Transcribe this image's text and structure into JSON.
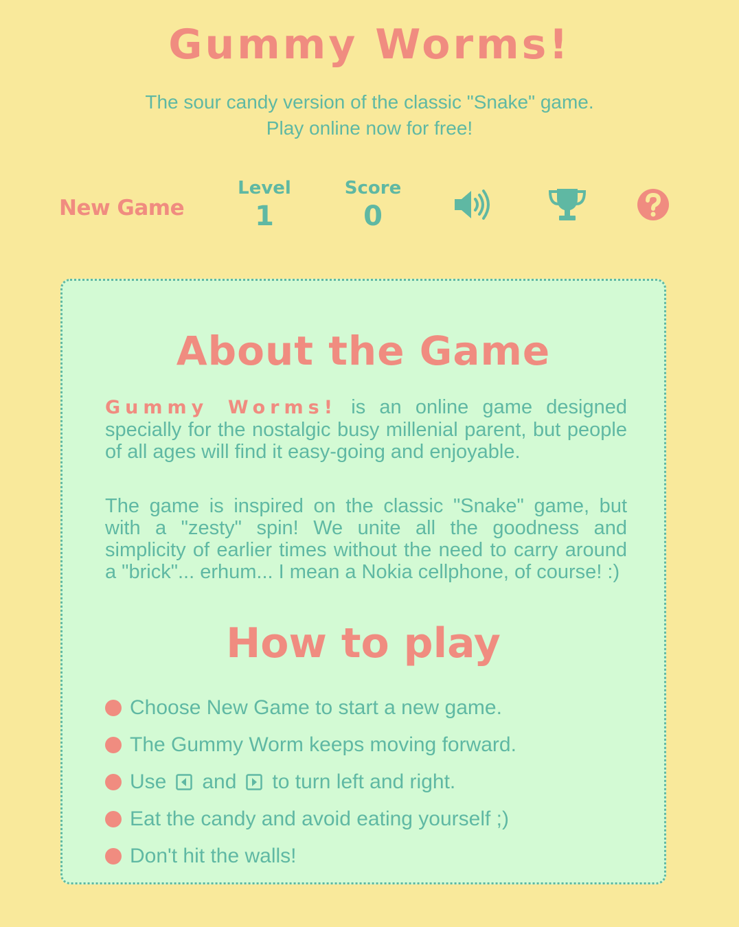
{
  "header": {
    "title": "Gummy Worms!",
    "subtitle_line1": "The sour candy version of the classic \"Snake\" game.",
    "subtitle_line2": "Play online now for free!"
  },
  "toolbar": {
    "new_game_label": "New Game",
    "level_label": "Level",
    "level_value": "1",
    "score_label": "Score",
    "score_value": "0",
    "icons": [
      "speaker-icon",
      "trophy-icon",
      "help-icon"
    ]
  },
  "about": {
    "heading": "About the Game",
    "brand": "Gummy Worms!",
    "para1_rest": " is an online game designed specially for the nostalgic busy millenial parent, but people of all ages will find it easy-going and enjoyable.",
    "para2": "The game is inspired on the classic \"Snake\" game, but with a \"zesty\" spin! We unite all the goodness and simplicity of earlier times without the need to carry around a \"brick\"... erhum... I mean a Nokia cellphone, of course! :)"
  },
  "howto": {
    "heading": "How to play",
    "item1": "Choose New Game to start a new game.",
    "item2": "The Gummy Worm keeps moving forward.",
    "item3_a": "Use",
    "item3_b": "and",
    "item3_c": "to turn left and right.",
    "item4": "Eat the candy and avoid eating yourself ;)",
    "item5": "Don't hit the walls!"
  },
  "colors": {
    "background": "#f9e99b",
    "accent": "#f08c80",
    "teal": "#5fb8a3",
    "panel": "#d3fad4"
  }
}
